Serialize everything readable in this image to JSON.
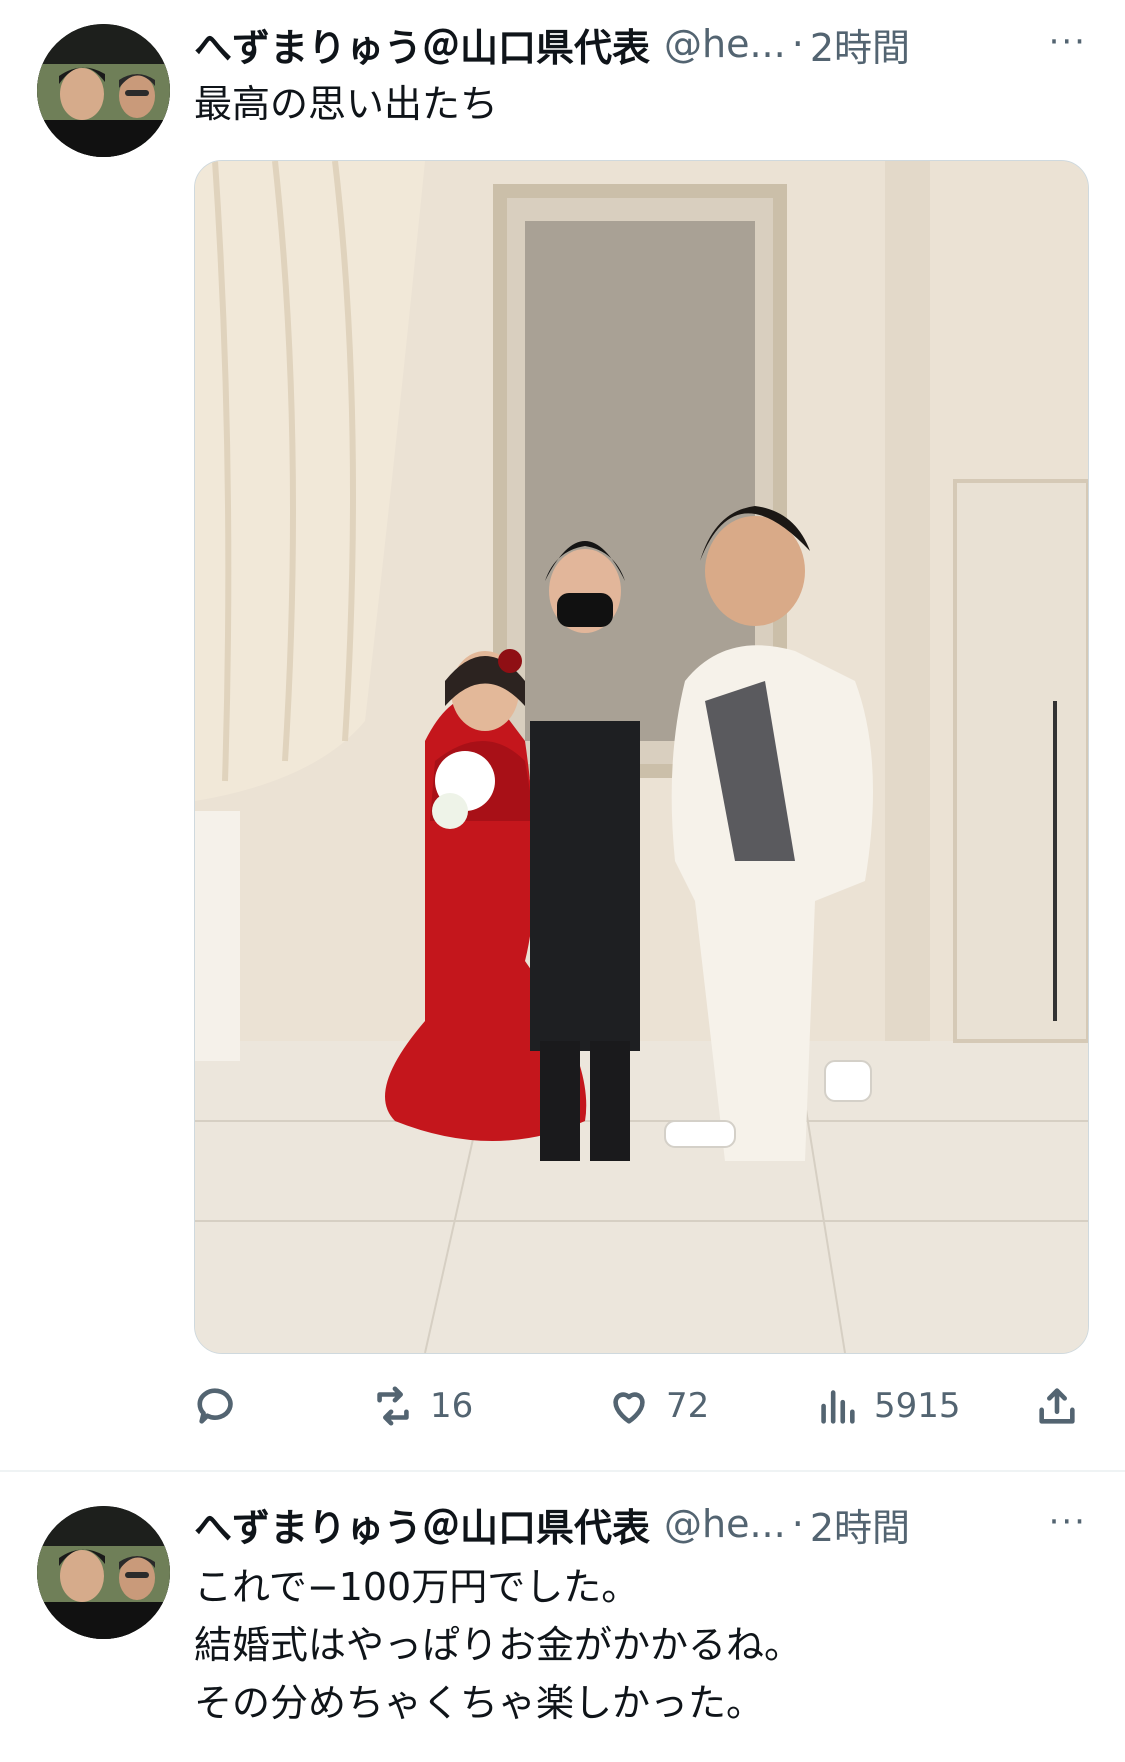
{
  "tweets": [
    {
      "author_name": "へずまりゅう＠山口県代表",
      "handle": "@he...",
      "separator": "·",
      "time": "2時間",
      "more": "···",
      "text": "最高の思い出たち",
      "actions": {
        "reply": "",
        "retweet": "16",
        "like": "72",
        "views": "5915",
        "share": ""
      }
    },
    {
      "author_name": "へずまりゅう＠山口県代表",
      "handle": "@he...",
      "separator": "·",
      "time": "2時間",
      "more": "···",
      "text": "これで−100万円でした。\n結婚式はやっぱりお金がかかるね。\nその分めちゃくちゃ楽しかった。"
    }
  ],
  "colors": {
    "text": "#0f1419",
    "secondary": "#536471",
    "divider": "#eff3f4",
    "dress_red": "#c4161c"
  }
}
